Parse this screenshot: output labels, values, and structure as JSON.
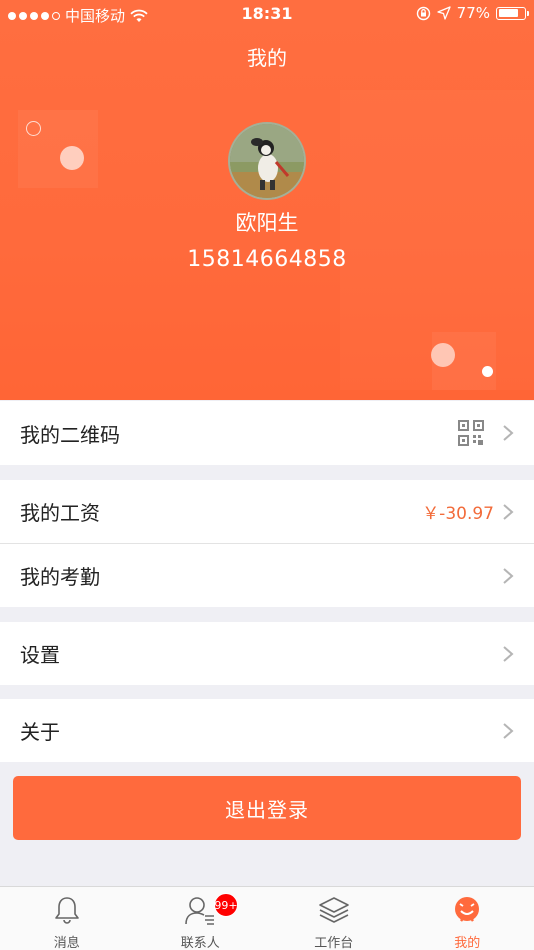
{
  "status_bar": {
    "carrier": "中国移动",
    "time": "18:31",
    "battery": "77%",
    "battery_level": 0.77
  },
  "header": {
    "title": "我的",
    "user_name": "欧阳生",
    "phone": "15814664858"
  },
  "menu": {
    "qr_label": "我的二维码",
    "salary_label": "我的工资",
    "salary_amount": "￥-30.97",
    "attendance_label": "我的考勤",
    "settings_label": "设置",
    "about_label": "关于"
  },
  "logout_label": "退出登录",
  "tabbar": {
    "messages": "消息",
    "contacts": "联系人",
    "workbench": "工作台",
    "workbench_badge": "99+",
    "mine": "我的"
  },
  "colors": {
    "accent": "#ff6a3d",
    "amount": "#f26b3a",
    "badge": "#ff0000"
  },
  "icons": [
    "wifi-icon",
    "lock-rotation-icon",
    "location-arrow-icon",
    "qr-code-icon",
    "chevron-right-icon",
    "bell-icon",
    "contact-icon",
    "layers-icon",
    "mine-face-icon"
  ]
}
